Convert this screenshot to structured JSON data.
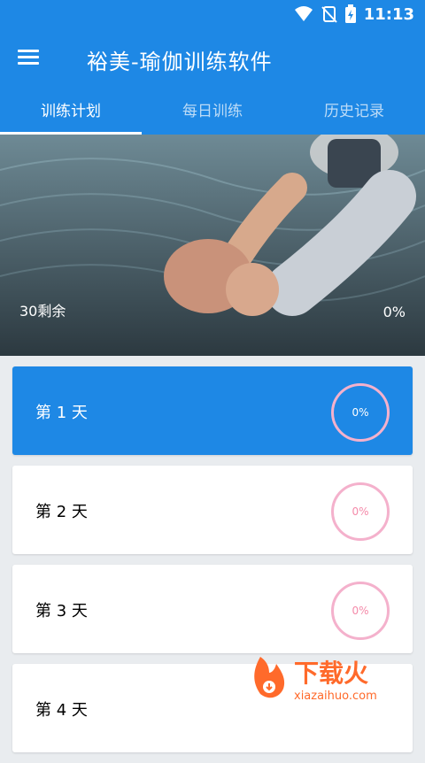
{
  "status": {
    "time": "11:13"
  },
  "app": {
    "title": "裕美-瑜伽训练软件"
  },
  "tabs": [
    {
      "label": "训练计划",
      "active": true
    },
    {
      "label": "每日训练",
      "active": false
    },
    {
      "label": "历史记录",
      "active": false
    }
  ],
  "hero": {
    "remaining": "30剩余",
    "percent": "0%"
  },
  "days": [
    {
      "label": "第 1 天",
      "progress": "0%"
    },
    {
      "label": "第 2 天",
      "progress": "0%"
    },
    {
      "label": "第 3 天",
      "progress": "0%"
    },
    {
      "label": "第 4 天",
      "progress": ""
    }
  ],
  "watermark": {
    "brand": "下载火",
    "domain": "xiazaihuo.com"
  },
  "colors": {
    "primary": "#1e88e5",
    "ring": "#f4b1cc",
    "ring_text": "#f48aa9"
  }
}
